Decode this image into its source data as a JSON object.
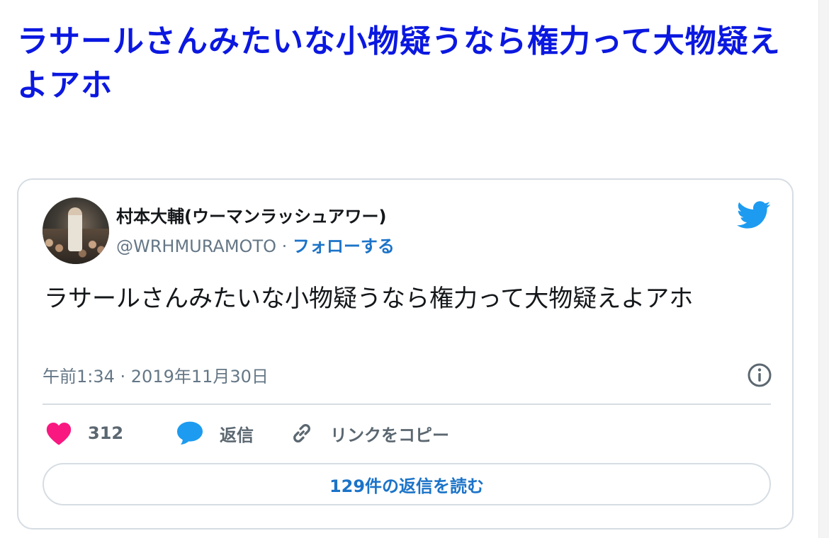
{
  "page": {
    "title": "ラサールさんみたいな小物疑うなら権力って大物疑えよアホ"
  },
  "tweet": {
    "author_name": "村本大輔(ウーマンラッシュアワー)",
    "handle": "@WRHMURAMOTO",
    "separator": " · ",
    "follow_label": "フォローする",
    "text": "ラサールさんみたいな小物疑うなら権力って大物疑えよアホ",
    "timestamp": "午前1:34 · 2019年11月30日",
    "likes_count": "312",
    "reply_label": "返信",
    "copy_link_label": "リンクをコピー",
    "read_replies_label": "129件の返信を読む"
  },
  "colors": {
    "title": "#0b18e0",
    "link": "#1b73c8",
    "heart": "#f91880",
    "reply_bubble": "#1d9bf0",
    "twitter_bird": "#1d9bf0",
    "text": "#14171a",
    "muted": "#657786"
  },
  "icons": [
    "twitter-bird-icon",
    "info-icon",
    "heart-icon",
    "reply-bubble-icon",
    "link-icon"
  ]
}
